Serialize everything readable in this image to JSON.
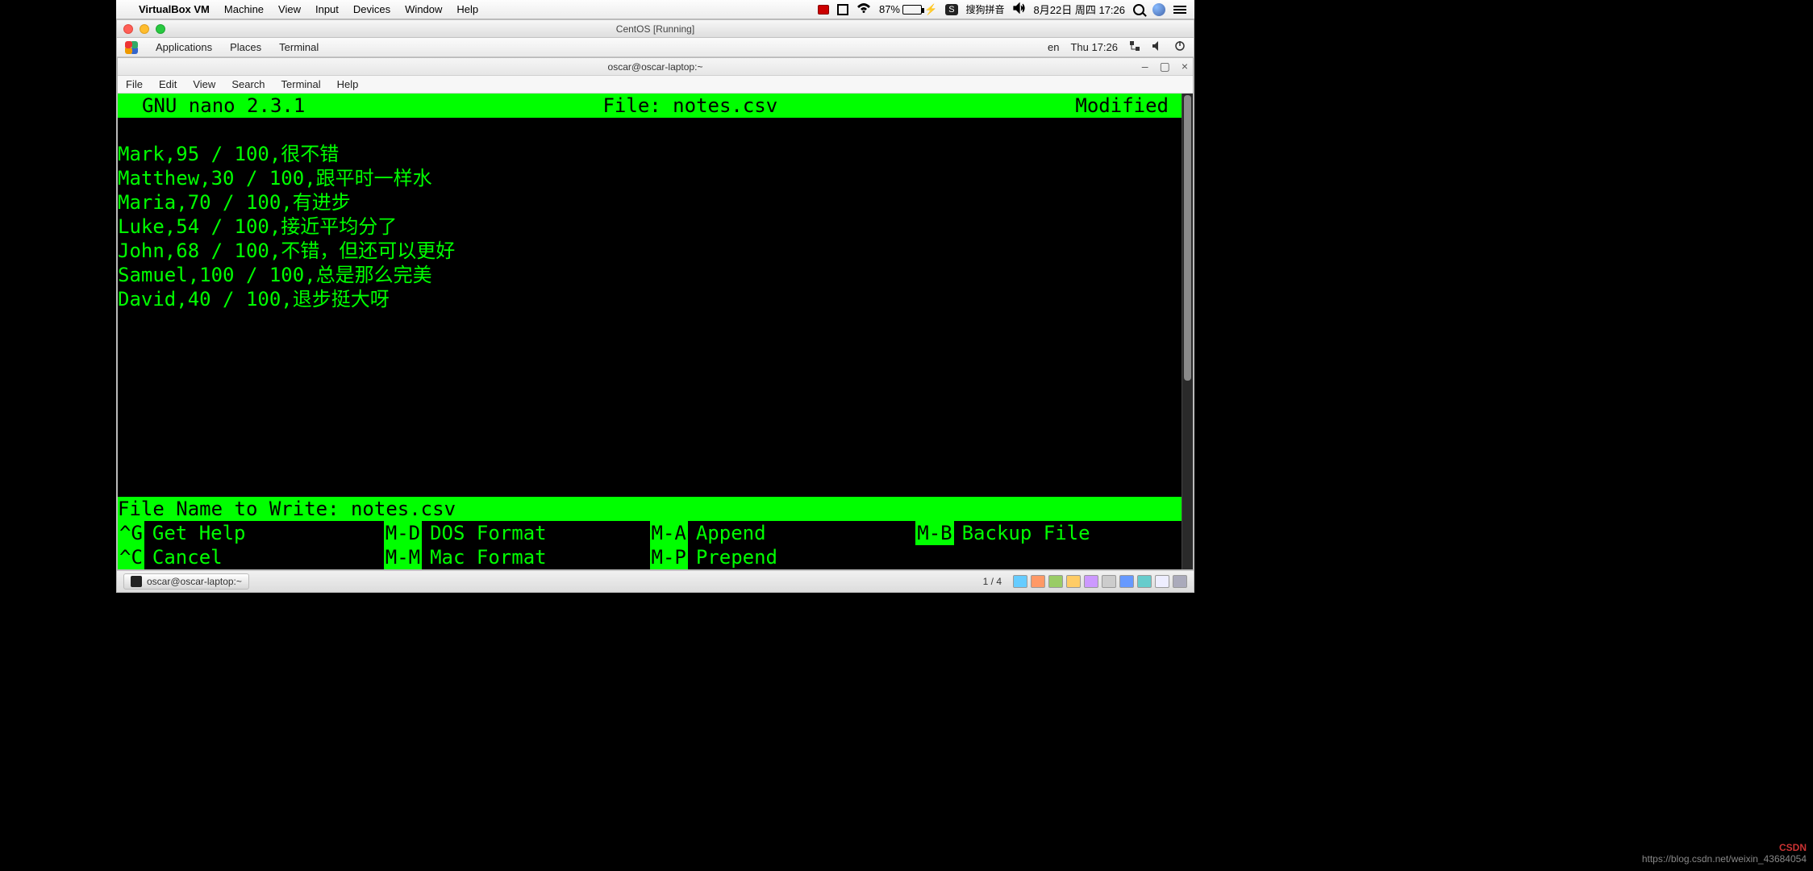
{
  "mac_menu": {
    "app": "VirtualBox VM",
    "items": [
      "Machine",
      "View",
      "Input",
      "Devices",
      "Window",
      "Help"
    ],
    "battery_pct": "87%",
    "ime": "搜狗拼音",
    "datetime": "8月22日 周四 17:26"
  },
  "vm": {
    "title": "CentOS [Running]"
  },
  "gnome_panel": {
    "apps": "Applications",
    "places": "Places",
    "terminal": "Terminal",
    "lang": "en",
    "clock": "Thu 17:26"
  },
  "term": {
    "title": "oscar@oscar-laptop:~",
    "menus": [
      "File",
      "Edit",
      "View",
      "Search",
      "Terminal",
      "Help"
    ]
  },
  "nano": {
    "app_title": "GNU nano 2.3.1",
    "file_label": "File: notes.csv",
    "modified": "Modified",
    "content": "Mark,95 / 100,很不错\nMatthew,30 / 100,跟平时一样水\nMaria,70 / 100,有进步\nLuke,54 / 100,接近平均分了\nJohn,68 / 100,不错，但还可以更好\nSamuel,100 / 100,总是那么完美\nDavid,40 / 100,退步挺大呀",
    "prompt": "File Name to Write: notes.csv",
    "shortcuts": [
      {
        "key": "^G",
        "label": "Get Help"
      },
      {
        "key": "M-D",
        "label": "DOS Format"
      },
      {
        "key": "M-A",
        "label": "Append"
      },
      {
        "key": "M-B",
        "label": "Backup File"
      },
      {
        "key": "^C",
        "label": "Cancel"
      },
      {
        "key": "M-M",
        "label": "Mac Format"
      },
      {
        "key": "M-P",
        "label": "Prepend"
      },
      {
        "key": "",
        "label": ""
      }
    ]
  },
  "taskbar": {
    "task": "oscar@oscar-laptop:~",
    "workspace": "1 / 4"
  },
  "watermark": {
    "line1": "CSDN",
    "line2": "https://blog.csdn.net/weixin_43684054"
  }
}
